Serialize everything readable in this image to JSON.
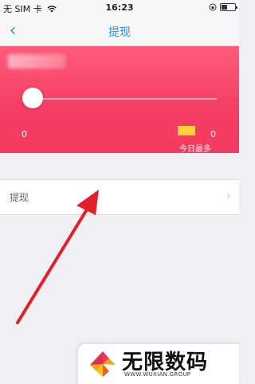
{
  "status_bar": {
    "carrier": "无 SIM 卡",
    "wifi_icon": "wifi-icon",
    "time": "16:23",
    "battery_icon": "battery-icon"
  },
  "nav": {
    "back_icon": "chevron-left-icon",
    "title": "提现"
  },
  "withdraw_panel": {
    "slider_value": 0,
    "min_value": "0",
    "max_value": "0",
    "today_max_label": "今日最多"
  },
  "list": {
    "items": [
      {
        "label": "提现",
        "chevron_icon": "chevron-right-icon"
      }
    ]
  },
  "watermark": {
    "brand": "无限数码",
    "site": "WWW.WUXIAN.GROUP"
  },
  "colors": {
    "card_red": "#f53d63",
    "nav_blue": "#2d8cf0",
    "arrow_red": "#e0202a"
  }
}
